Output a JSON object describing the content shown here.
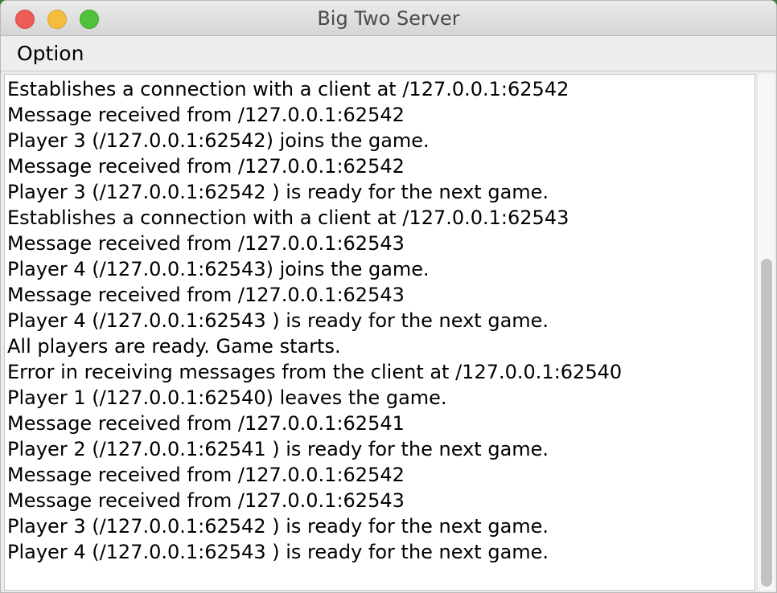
{
  "window": {
    "title": "Big Two Server"
  },
  "menubar": {
    "items": [
      {
        "label": "Option"
      }
    ]
  },
  "log": {
    "lines": [
      "Establishes a connection with a client at /127.0.0.1:62542",
      "Message received from /127.0.0.1:62542",
      "Player 3 (/127.0.0.1:62542) joins the game.",
      "Message received from /127.0.0.1:62542",
      "Player 3 (/127.0.0.1:62542 ) is ready for the next game.",
      "Establishes a connection with a client at /127.0.0.1:62543",
      "Message received from /127.0.0.1:62543",
      "Player 4 (/127.0.0.1:62543) joins the game.",
      "Message received from /127.0.0.1:62543",
      "Player 4 (/127.0.0.1:62543 ) is ready for the next game.",
      "All players are ready. Game starts.",
      "Error in receiving messages from the client at /127.0.0.1:62540",
      "Player 1 (/127.0.0.1:62540) leaves the game.",
      "Message received from /127.0.0.1:62541",
      "Player 2 (/127.0.0.1:62541 ) is ready for the next game.",
      "Message received from /127.0.0.1:62542",
      "Message received from /127.0.0.1:62543",
      "Player 3 (/127.0.0.1:62542 ) is ready for the next game.",
      "Player 4 (/127.0.0.1:62543 ) is ready for the next game."
    ]
  },
  "colors": {
    "close": "#ee5c55",
    "minimize": "#f5bd3c",
    "zoom": "#4fc23a"
  }
}
